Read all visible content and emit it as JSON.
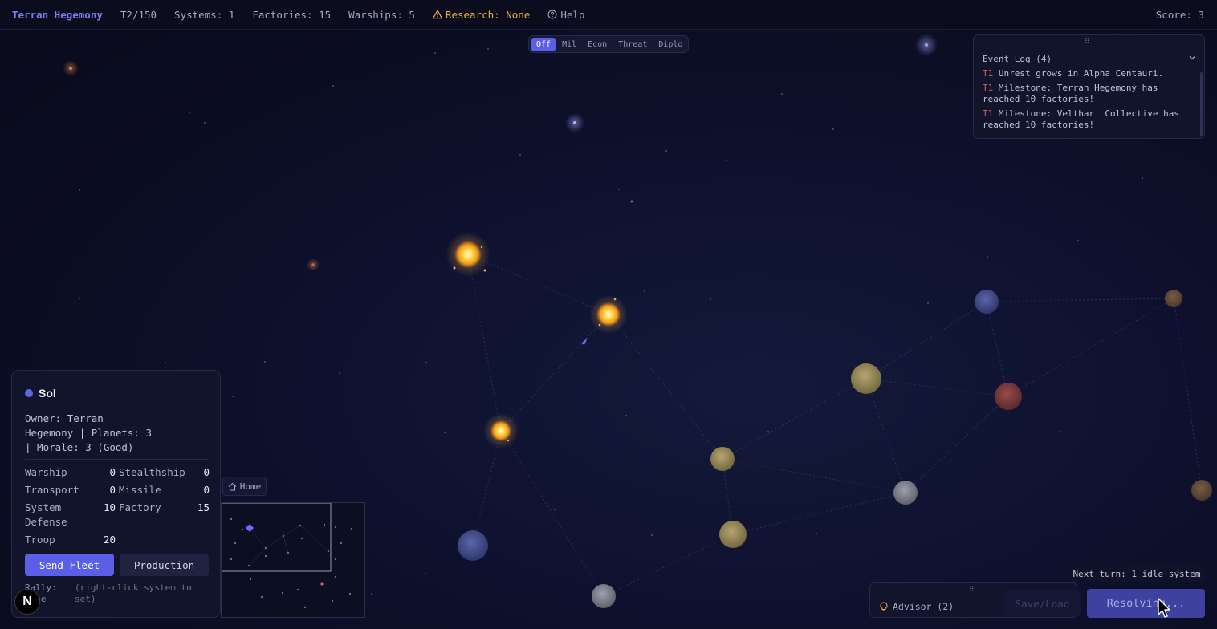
{
  "topbar": {
    "title": "Terran Hegemony",
    "turn": "T2/150",
    "systems": "Systems: 1",
    "factories": "Factories: 15",
    "warships": "Warships: 5",
    "research": "Research: None",
    "help": "Help",
    "score": "Score: 3"
  },
  "overlay": {
    "options": [
      "Off",
      "Mil",
      "Econ",
      "Threat",
      "Diplo"
    ],
    "active": "Off"
  },
  "event_log": {
    "title": "Event Log (4)",
    "entries": [
      {
        "turn": "T1",
        "text": " Unrest grows in Alpha Centauri."
      },
      {
        "turn": "T1",
        "text": " Milestone: Terran Hegemony has reached 10 factories!"
      },
      {
        "turn": "T1",
        "text": " Milestone: Velthari Collective has reached 10 factories!"
      }
    ]
  },
  "system_panel": {
    "name": "Sol",
    "owner_info": "Owner: Terran Hegemony | Planets: 3 | Morale: 3 (Good)",
    "stats": [
      {
        "label": "Warship",
        "value": "0"
      },
      {
        "label": "Stealthship",
        "value": "0"
      },
      {
        "label": "Transport",
        "value": "0"
      },
      {
        "label": "Missile",
        "value": "0"
      },
      {
        "label": "System Defense",
        "value": "10"
      },
      {
        "label": "Factory",
        "value": "15"
      },
      {
        "label": "Troop",
        "value": "20"
      }
    ],
    "send_fleet": "Send Fleet",
    "production": "Production",
    "rally_label": "Rally: None",
    "rally_hint": "(right-click system to set)"
  },
  "home_button": "Home",
  "next_turn": "Next turn: 1 idle system",
  "advisor": "Advisor (2)",
  "save_load": "Save/Load",
  "resolving": "Resolving...",
  "badge": "N",
  "colors": {
    "accent": "#5b5ee6",
    "title": "#7c7ff2",
    "research": "#e9b546",
    "turn_tag": "#d65b6a",
    "background": "#0f1230"
  },
  "icons": [
    "warning-icon",
    "help-circle-icon",
    "chevron-down-icon",
    "chevron-up-icon",
    "home-icon",
    "lightbulb-icon",
    "drag-grip-icon",
    "cursor-icon"
  ]
}
